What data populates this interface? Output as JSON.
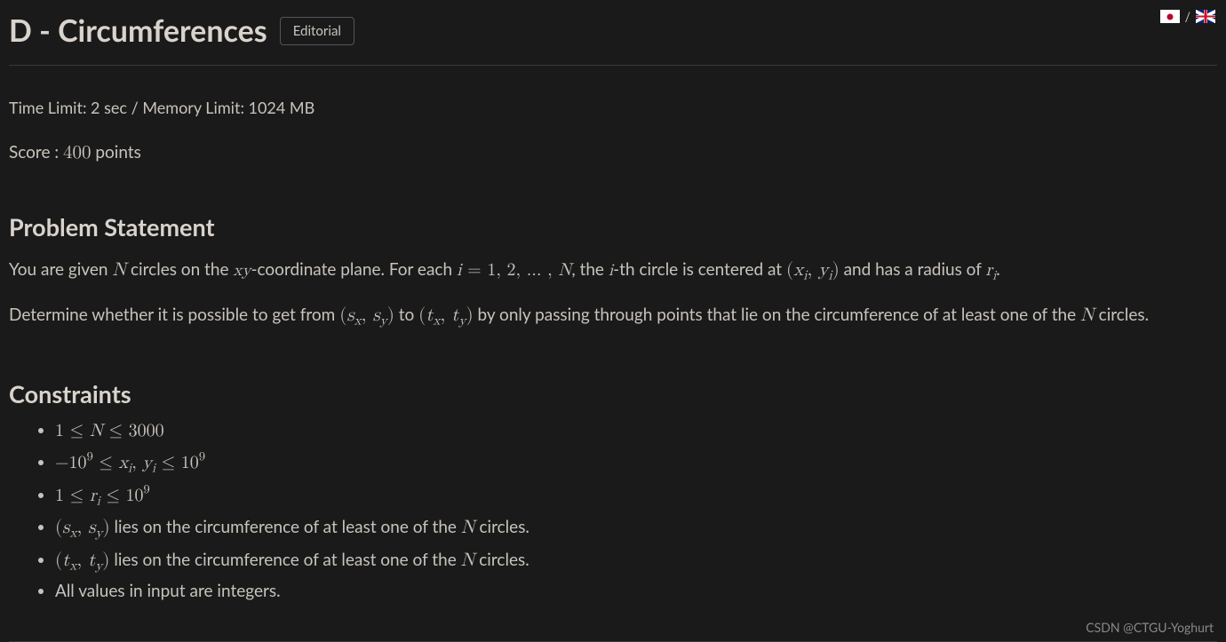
{
  "header": {
    "title": "D - Circumferences",
    "editorial_label": "Editorial"
  },
  "flags": {
    "sep": "/"
  },
  "limits": "Time Limit: 2 sec / Memory Limit: 1024 MB",
  "score": {
    "prefix": "Score : ",
    "value": "400",
    "suffix": " points"
  },
  "problem_statement_heading": "Problem Statement",
  "ps": {
    "p1_a": "You are given ",
    "p1_b": " circles on the ",
    "p1_c": "-coordinate plane. For each ",
    "p1_d": ", the ",
    "p1_e": "-th circle is centered at ",
    "p1_f": " and has a radius of ",
    "p1_g": ".",
    "p2_a": "Determine whether it is possible to get from ",
    "p2_b": " to ",
    "p2_c": " by only passing through points that lie on the circumference of at least one of the ",
    "p2_d": " circles."
  },
  "constraints_heading": "Constraints",
  "constraints": {
    "c4_a": " lies on the circumference of at least one of the ",
    "c4_b": " circles.",
    "c5_a": " lies on the circumference of at least one of the ",
    "c5_b": " circles.",
    "c6": "All values in input are integers."
  },
  "math": {
    "N": "N",
    "xy": "xy",
    "i_eq": "i = 1, 2, … , N",
    "i": "i",
    "xi_yi": "(x",
    "xi_yi_mid": ", y",
    "xi_yi_close": ")",
    "ri": "r",
    "sx_sy": "(s",
    "sx_sy_mid": ", s",
    "sx_sy_close": ")",
    "tx_ty": "(t",
    "tx_ty_mid": ", t",
    "tx_ty_close": ")",
    "sub_i": "i",
    "sub_x": "x",
    "sub_y": "y"
  },
  "watermark": "CSDN @CTGU-Yoghurt"
}
